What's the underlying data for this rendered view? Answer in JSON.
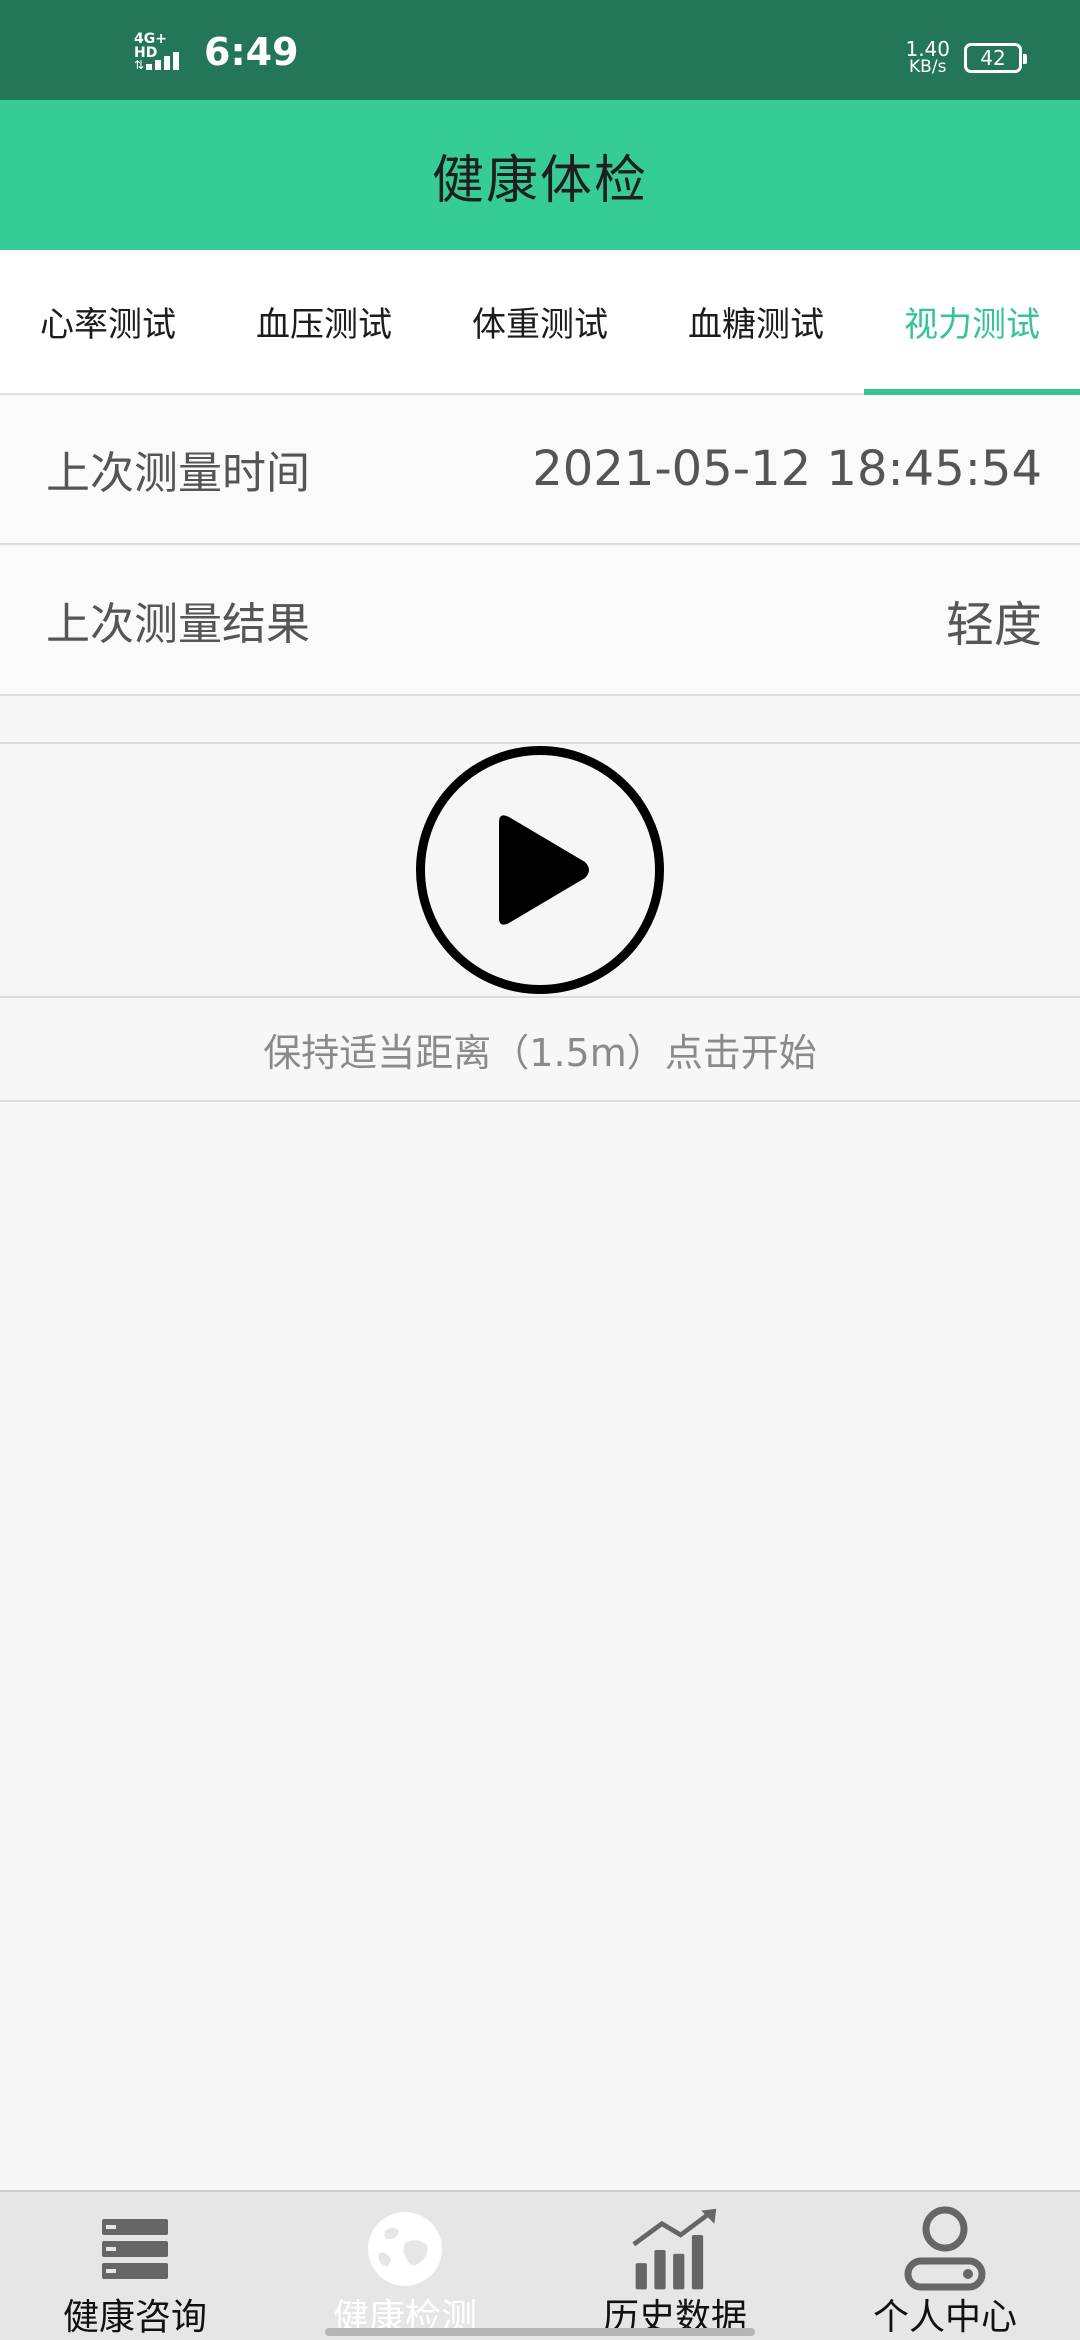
{
  "status_bar": {
    "network": "4G+ HD",
    "time": "6:49",
    "speed_value": "1.40",
    "speed_unit": "KB/s",
    "battery": "42"
  },
  "header": {
    "title": "健康体检"
  },
  "tabs": [
    {
      "label": "心率测试",
      "active": false
    },
    {
      "label": "血压测试",
      "active": false
    },
    {
      "label": "体重测试",
      "active": false
    },
    {
      "label": "血糖测试",
      "active": false
    },
    {
      "label": "视力测试",
      "active": true
    }
  ],
  "last_time": {
    "label": "上次测量时间",
    "value": "2021-05-12 18:45:54"
  },
  "last_result": {
    "label": "上次测量结果",
    "value": "轻度"
  },
  "play": {
    "icon": "play-circle-icon"
  },
  "hint": "保持适当距离（1.5m）点击开始",
  "bottom_nav": [
    {
      "label": "健康咨询",
      "icon": "server-list-icon",
      "active": false
    },
    {
      "label": "健康检测",
      "icon": "globe-icon",
      "active": true
    },
    {
      "label": "历史数据",
      "icon": "bar-chart-trend-icon",
      "active": false
    },
    {
      "label": "个人中心",
      "icon": "person-icon",
      "active": false
    }
  ],
  "colors": {
    "status_bar": "#237657",
    "header": "#36cc97",
    "accent": "#36c494"
  }
}
